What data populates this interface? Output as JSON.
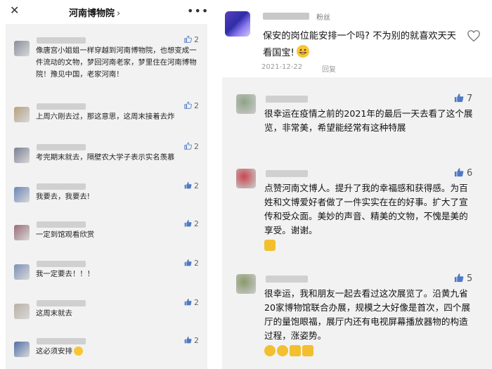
{
  "left_panel": {
    "title": "河南博物院",
    "title_chevron": "›",
    "close_icon": "close-icon",
    "more_icon": "more-dots-icon",
    "comments": [
      {
        "avatar_color": "#8a8f9c",
        "text": "像唐宫小姐姐一样穿越到河南博物院，也想变成一件流动的文物，梦回河南老家，梦里住在河南博物院！豫见中国，老家河南！",
        "likes": "2",
        "liked": false
      },
      {
        "avatar_color": "#b6a07e",
        "text": "上周六刚去过，那这意思，这周末接着去炸",
        "likes": "2",
        "liked": false
      },
      {
        "avatar_color": "#7a7f92",
        "text": "考完期末就去，隔壁农大学子表示实名羡慕",
        "likes": "2",
        "liked": false
      },
      {
        "avatar_color": "#6a86b8",
        "text": "我要去，我要去!",
        "likes": "2",
        "liked": true
      },
      {
        "avatar_color": "#9a6c76",
        "text": "一定到馆观看欣赏",
        "likes": "2",
        "liked": true
      },
      {
        "avatar_color": "#7b8fb8",
        "text": "我一定要去！！！",
        "likes": "2",
        "liked": true
      },
      {
        "avatar_color": "#b9b0a6",
        "text": "这周末就去",
        "likes": "2",
        "liked": true
      },
      {
        "avatar_color": "#4f6fa8",
        "text": "这必须安排",
        "likes": "2",
        "liked": true
      }
    ]
  },
  "right_panel": {
    "top_comment": {
      "badge": "粉丝",
      "text": "保安的岗位能安排一个吗? 不为别的就喜欢天天看国宝!",
      "date": "2021-12-22",
      "reply_label": "回复",
      "heart_icon": "heart-outline-icon"
    },
    "comments": [
      {
        "avatar_color": "#8fa486",
        "text": "很幸运在疫情之前的2021年的最后一天去看了这个展览，非常美，希望能经常有这种特展",
        "likes": "7"
      },
      {
        "avatar_color": "#c9474f",
        "text": "点赞河南文博人。提升了我的幸福感和获得感。为百姓和文博爱好者做了一件实实在在的好事。扩大了宣传和受众面。美妙的声音、精美的文物，不愧是美的享受。谢谢。",
        "likes": "6"
      },
      {
        "avatar_color": "#8a9a6a",
        "text": "很幸运，我和朋友一起去看过这次展览了。沿黄九省20家博物馆联合办展，规模之大好像是首次，四个展厅的量饱眼福，展厅内还有电视屏幕播放器物的构造过程，涨姿势。",
        "likes": "5"
      }
    ]
  },
  "colors": {
    "like_blue": "#4f79c4",
    "panel_gray": "#f2f2f2"
  }
}
